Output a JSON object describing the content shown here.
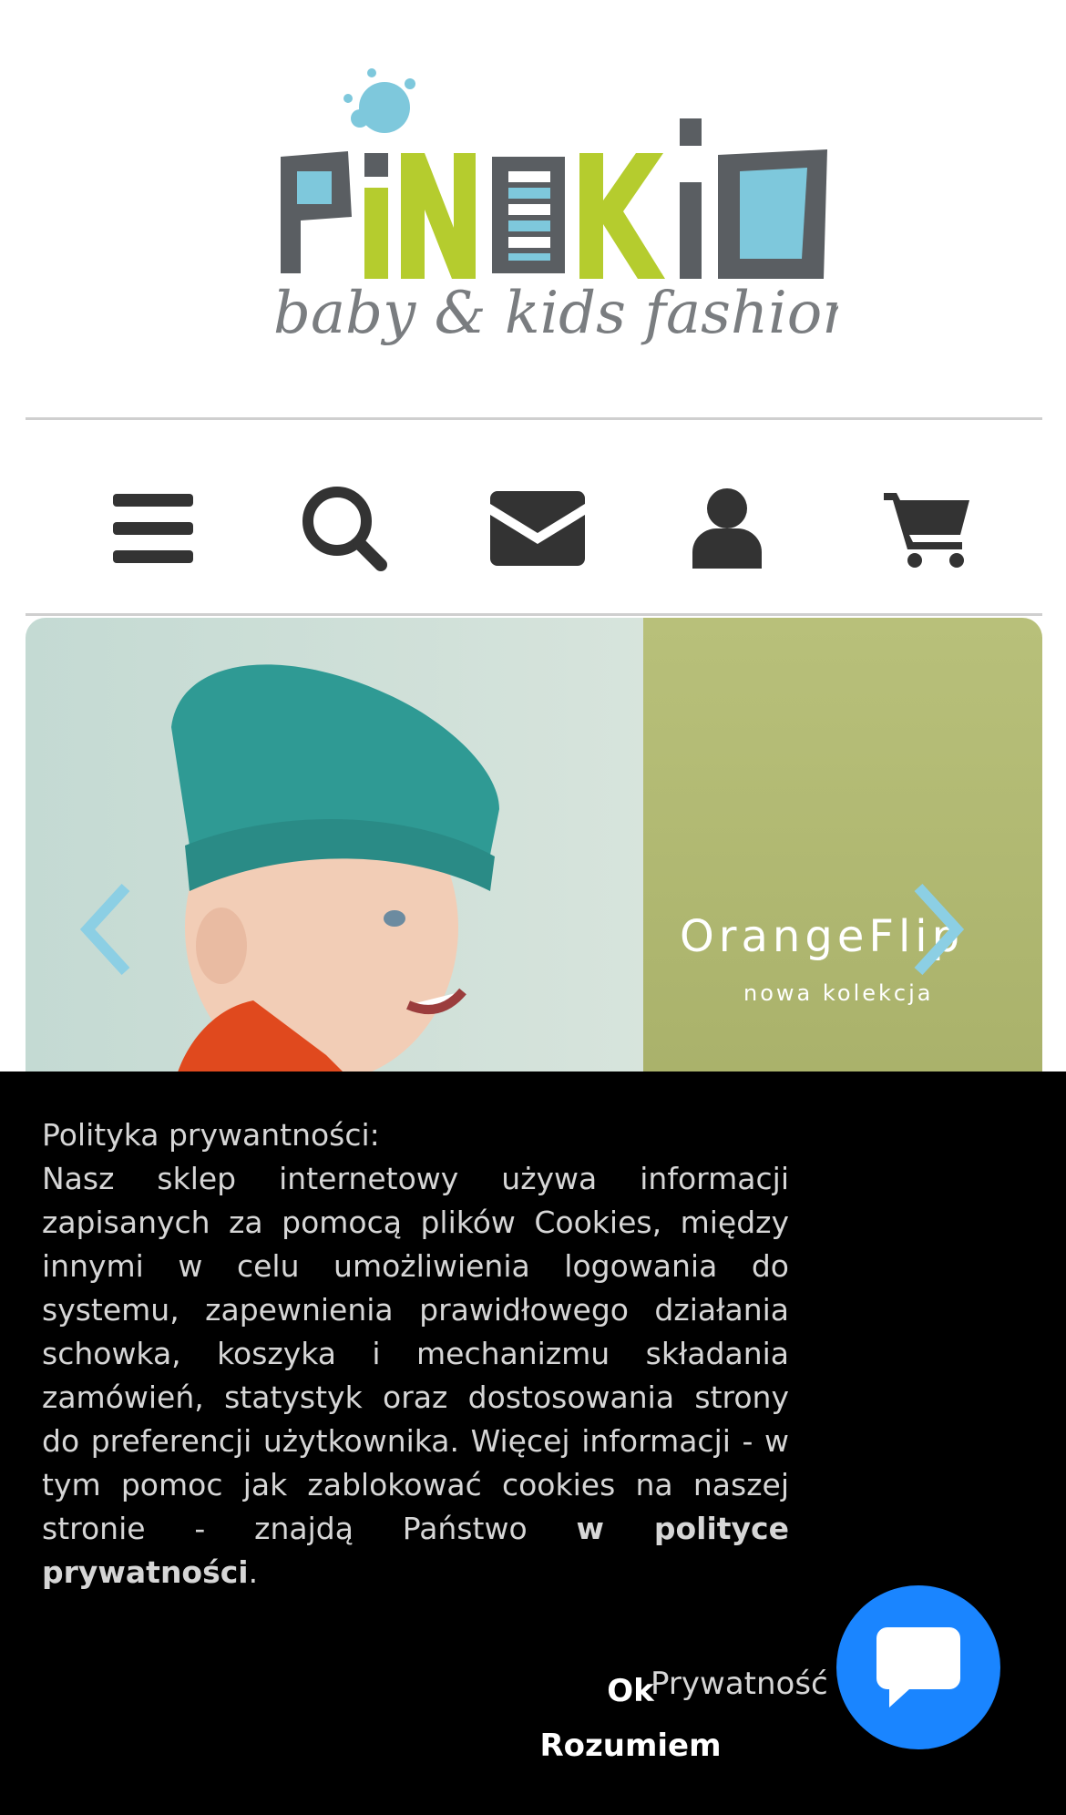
{
  "logo": {
    "name": "PINOKIO",
    "tagline": "baby & kids fashion"
  },
  "nav_icons": [
    {
      "name": "menu-icon"
    },
    {
      "name": "search-icon"
    },
    {
      "name": "envelope-icon"
    },
    {
      "name": "user-icon"
    },
    {
      "name": "cart-icon"
    }
  ],
  "slider": {
    "title": "OrangeFlip",
    "subtitle": "nowa kolekcja",
    "prev_icon": "chevron-left-icon",
    "next_icon": "chevron-right-icon"
  },
  "cookie": {
    "title": "Polityka prywantności:",
    "body": "Nasz sklep internetowy używa informacji zapisanych za pomocą plików Cookies, między innymi w celu umożliwienia logowania do systemu, zapewnienia prawidłowego działania schowka, koszyka i mechanizmu składania zamówień, statystyk oraz dostosowania strony do preferencji użytkownika. Więcej informacji - w tym pomoc jak zablokować cookies na naszej stronie - znajdą Państwo",
    "link_text": "w polityce prywatności",
    "end": ".",
    "ok_label": "Ok Rozumiem",
    "privacy_label": "Prywatność"
  },
  "chat": {
    "icon": "chat-icon"
  },
  "colors": {
    "accent_blue": "#7ec8dc",
    "accent_green": "#b5cc2e",
    "logo_gray": "#5a5e62",
    "icon_dark": "#333333",
    "chat_blue": "#1a85ff",
    "banner_bg": "#000000"
  }
}
